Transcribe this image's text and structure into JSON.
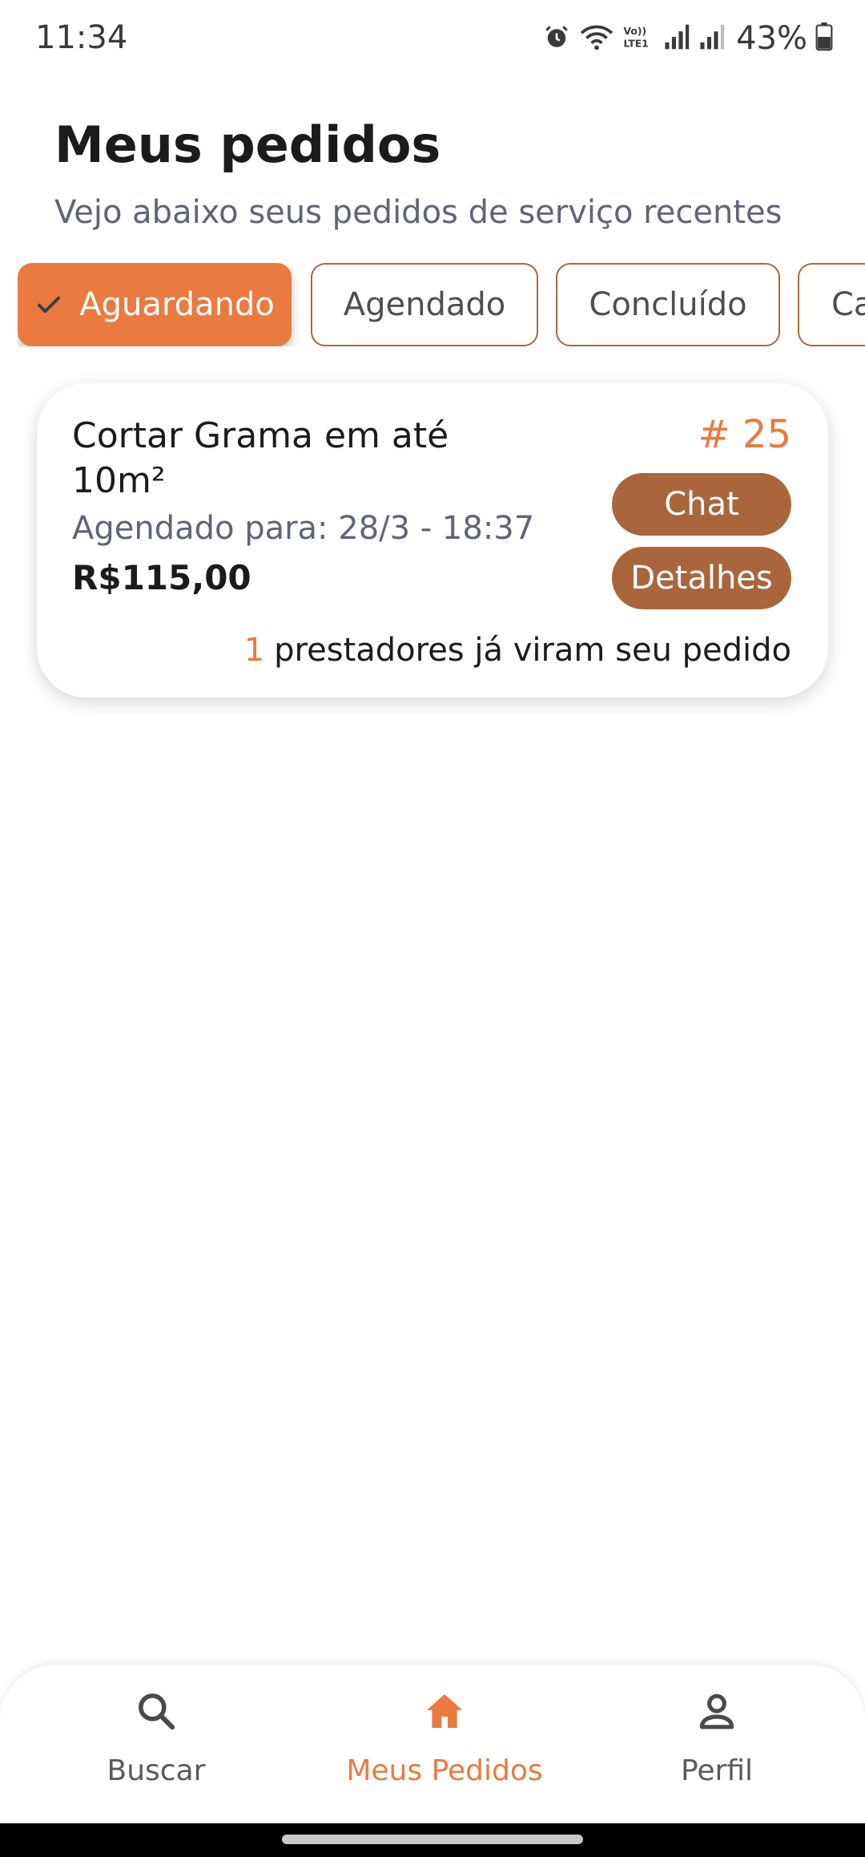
{
  "status_bar": {
    "time": "11:34",
    "battery": "43%",
    "icons": [
      "alarm-icon",
      "wifi-icon",
      "volte-icon",
      "signal-icon",
      "signal-icon",
      "battery-icon"
    ]
  },
  "header": {
    "title": "Meus pedidos",
    "subtitle": "Vejo abaixo seus pedidos de serviço recentes"
  },
  "filters": {
    "chips": [
      {
        "label": "Aguardando",
        "selected": true
      },
      {
        "label": "Agendado",
        "selected": false
      },
      {
        "label": "Concluído",
        "selected": false
      },
      {
        "label": "Ca",
        "selected": false
      }
    ]
  },
  "orders": [
    {
      "title": "Cortar Grama em até 10m²",
      "schedule": "Agendado para: 28/3 - 18:37",
      "price": "R$115,00",
      "number": "# 25",
      "chat_label": "Chat",
      "details_label": "Detalhes",
      "views_count": "1",
      "views_text": "prestadores já viram seu pedido"
    }
  ],
  "bottom_nav": {
    "items": [
      {
        "label": "Buscar",
        "icon": "search-icon",
        "active": false
      },
      {
        "label": "Meus Pedidos",
        "icon": "home-icon",
        "active": true
      },
      {
        "label": "Perfil",
        "icon": "person-icon",
        "active": false
      }
    ]
  },
  "colors": {
    "accent": "#ea7a3f",
    "button": "#a9663c",
    "muted_text": "#5f6577"
  }
}
